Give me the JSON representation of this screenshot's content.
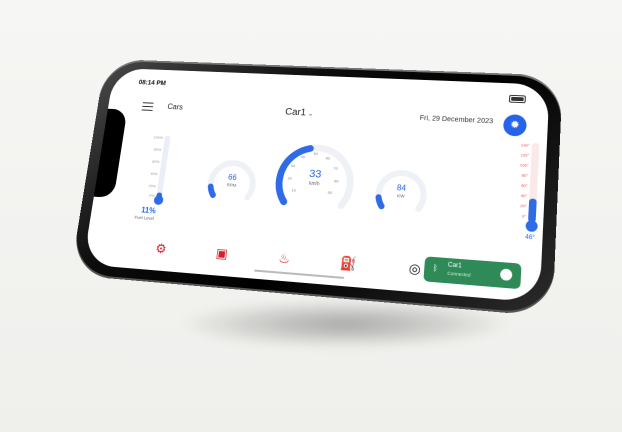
{
  "status": {
    "time": "08:14 PM"
  },
  "header": {
    "section_label": "Cars",
    "car_name": "Car1",
    "date": "Fri, 29 December 2023",
    "weather_icon": "sun-icon"
  },
  "fuel": {
    "level_percent": 11,
    "value": "11%",
    "label": "Fuel Level",
    "ticks": [
      "100%",
      "80%",
      "60%",
      "40%",
      "20%",
      "0%"
    ]
  },
  "gauges": {
    "rpm": {
      "value": "66",
      "unit": "RPM",
      "level": 0.1
    },
    "speed": {
      "value": "33",
      "unit": "km/h",
      "level": 0.45,
      "ticks": [
        "10",
        "20",
        "30",
        "40",
        "50",
        "60",
        "70",
        "80",
        "90"
      ]
    },
    "power": {
      "value": "84",
      "unit": "KW",
      "level": 0.1
    }
  },
  "temperature": {
    "value": "46°",
    "level_percent": 30,
    "ticks": [
      "140°",
      "120°",
      "100°",
      "80°",
      "60°",
      "40°",
      "20°",
      "0°"
    ]
  },
  "bottom": {
    "icons": [
      "engine-icon",
      "battery-icon",
      "oil-icon",
      "fuel-pump-icon",
      "tire-icon"
    ],
    "connection": {
      "title": "Car1",
      "status": "Connected"
    }
  },
  "colors": {
    "accent": "#2563eb",
    "warning": "#d61f2c",
    "connected": "#2e8b57"
  }
}
